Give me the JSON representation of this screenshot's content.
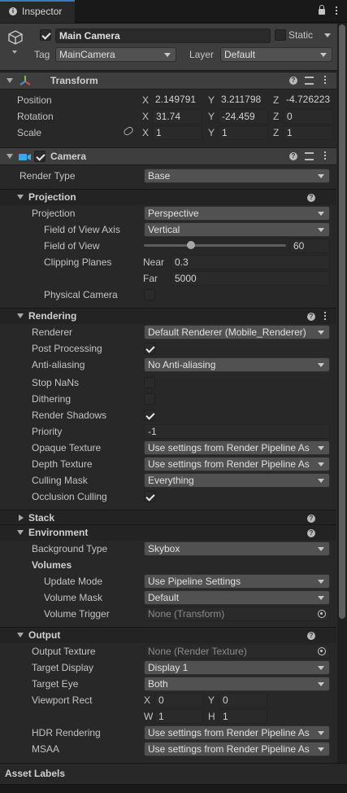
{
  "tab": {
    "title": "Inspector"
  },
  "header": {
    "object_name": "Main Camera",
    "static_label": "Static",
    "tag_label": "Tag",
    "tag_value": "MainCamera",
    "layer_label": "Layer",
    "layer_value": "Default"
  },
  "transform": {
    "title": "Transform",
    "position_label": "Position",
    "rotation_label": "Rotation",
    "scale_label": "Scale",
    "x": "X",
    "y": "Y",
    "z": "Z",
    "position": [
      "2.149791",
      "3.211798",
      "-4.726223"
    ],
    "rotation": [
      "31.74",
      "-24.459",
      "0"
    ],
    "scale": [
      "1",
      "1",
      "1"
    ]
  },
  "camera": {
    "title": "Camera",
    "render_type_label": "Render Type",
    "render_type_value": "Base",
    "projection": {
      "title": "Projection",
      "projection_label": "Projection",
      "projection_value": "Perspective",
      "fov_axis_label": "Field of View Axis",
      "fov_axis_value": "Vertical",
      "fov_label": "Field of View",
      "fov_value": "60",
      "fov_level": 0.33,
      "clipping_label": "Clipping Planes",
      "near_label": "Near",
      "near_value": "0.3",
      "far_label": "Far",
      "far_value": "5000",
      "physical_label": "Physical Camera"
    },
    "rendering": {
      "title": "Rendering",
      "renderer_label": "Renderer",
      "renderer_value": "Default Renderer (Mobile_Renderer)",
      "post_label": "Post Processing",
      "aa_label": "Anti-aliasing",
      "aa_value": "No Anti-aliasing",
      "stopnans_label": "Stop NaNs",
      "dithering_label": "Dithering",
      "shadows_label": "Render Shadows",
      "priority_label": "Priority",
      "priority_value": "-1",
      "opaque_label": "Opaque Texture",
      "opaque_value": "Use settings from Render Pipeline As",
      "depth_label": "Depth Texture",
      "depth_value": "Use settings from Render Pipeline As",
      "culling_label": "Culling Mask",
      "culling_value": "Everything",
      "occlusion_label": "Occlusion Culling"
    },
    "stack": {
      "title": "Stack"
    },
    "environment": {
      "title": "Environment",
      "bg_label": "Background Type",
      "bg_value": "Skybox",
      "volumes_label": "Volumes",
      "update_label": "Update Mode",
      "update_value": "Use Pipeline Settings",
      "mask_label": "Volume Mask",
      "mask_value": "Default",
      "trigger_label": "Volume Trigger",
      "trigger_value": "None (Transform)"
    },
    "output": {
      "title": "Output",
      "texture_label": "Output Texture",
      "texture_value": "None (Render Texture)",
      "display_label": "Target Display",
      "display_value": "Display 1",
      "eye_label": "Target Eye",
      "eye_value": "Both",
      "viewport_label": "Viewport Rect",
      "vp_x_label": "X",
      "vp_x": "0",
      "vp_y_label": "Y",
      "vp_y": "0",
      "vp_w_label": "W",
      "vp_w": "1",
      "vp_h_label": "H",
      "vp_h": "1",
      "hdr_label": "HDR Rendering",
      "hdr_value": "Use settings from Render Pipeline As",
      "msaa_label": "MSAA",
      "msaa_value": "Use settings from Render Pipeline As"
    }
  },
  "footer": {
    "asset_labels": "Asset Labels"
  },
  "colors": {
    "background": "#191919",
    "header": "#3e3e3e",
    "field": "#2a2a2a",
    "dropdown": "#515151",
    "camera_icon": "#3aa8e8"
  }
}
